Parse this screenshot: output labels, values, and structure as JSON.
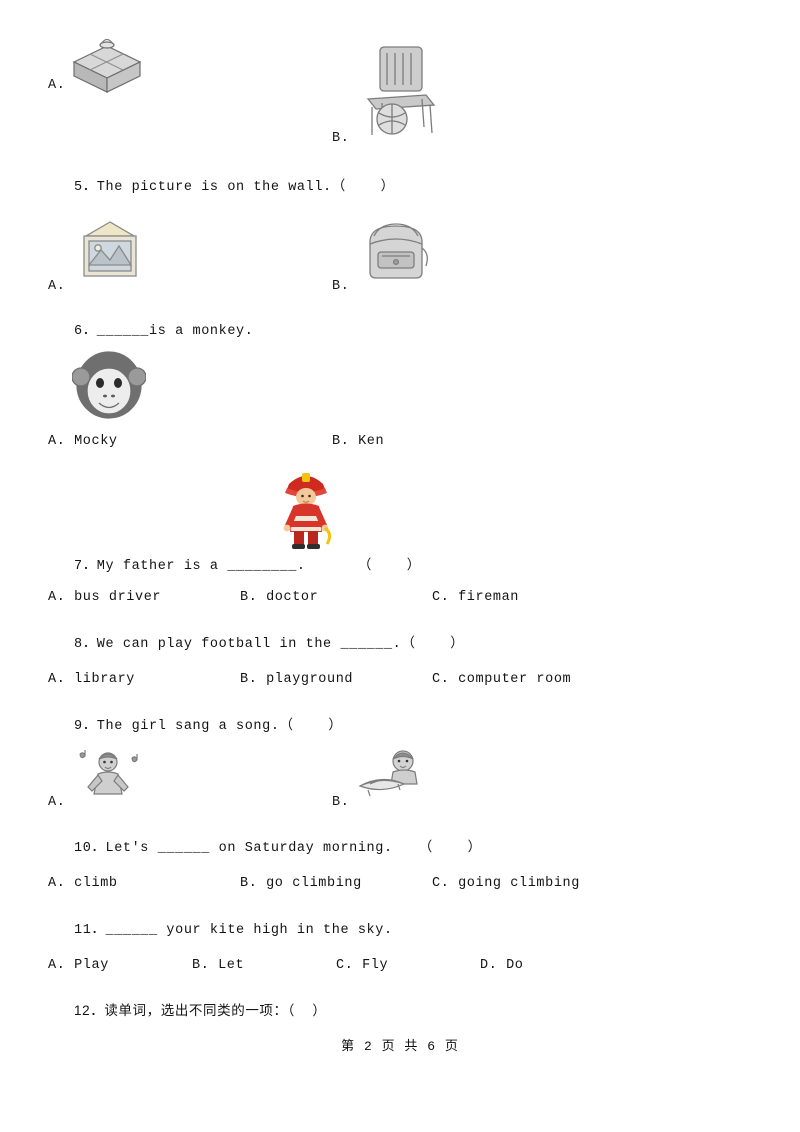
{
  "document": {
    "footer": "第 2 页 共 6 页",
    "footer_parts": {
      "prefix": "第",
      "page": "2",
      "mid": "页 共",
      "total": "6",
      "suffix": "页"
    }
  },
  "questions": [
    {
      "id": "q4-options",
      "kind": "image-options",
      "options": [
        {
          "label": "A.",
          "image": "cake-box-sketch"
        },
        {
          "label": "B.",
          "image": "chair-and-ball-sketch"
        }
      ]
    },
    {
      "id": "q5",
      "kind": "image-options",
      "text": "5．The picture is on the wall.（    ）",
      "options": [
        {
          "label": "A.",
          "image": "picture-frame-sketch"
        },
        {
          "label": "B.",
          "image": "schoolbag-sketch"
        }
      ]
    },
    {
      "id": "q6",
      "kind": "image-then-text-options",
      "text": "6．______is a monkey.",
      "image": "monkey-sketch",
      "options": [
        {
          "label": "A. Mocky"
        },
        {
          "label": "B. Ken"
        }
      ]
    },
    {
      "id": "q7",
      "kind": "image-then-text-options",
      "image": "fireman-color",
      "text": "7．My father is a ________.      （    ）",
      "options": [
        {
          "label": "A. bus driver"
        },
        {
          "label": "B. doctor"
        },
        {
          "label": "C. fireman"
        }
      ]
    },
    {
      "id": "q8",
      "kind": "text-options",
      "text": "8．We can play football in the ______.（    ）",
      "options": [
        {
          "label": "A. library"
        },
        {
          "label": "B. playground"
        },
        {
          "label": "C. computer room"
        }
      ]
    },
    {
      "id": "q9",
      "kind": "image-options",
      "text": "9．The girl sang a song.（    ）",
      "options": [
        {
          "label": "A.",
          "image": "girl-singing-sketch"
        },
        {
          "label": "B.",
          "image": "girl-reading-sketch"
        }
      ]
    },
    {
      "id": "q10",
      "kind": "text-options",
      "text": "10．Let's ______ on Saturday morning.   （    ）",
      "options": [
        {
          "label": "A. climb"
        },
        {
          "label": "B. go climbing"
        },
        {
          "label": "C. going climbing"
        }
      ]
    },
    {
      "id": "q11",
      "kind": "text-options",
      "text": "11．______ your kite high in the sky.",
      "options": [
        {
          "label": "A. Play"
        },
        {
          "label": "B. Let"
        },
        {
          "label": "C. Fly"
        },
        {
          "label": "D. Do"
        }
      ]
    },
    {
      "id": "q12",
      "kind": "text-only",
      "text": "12．读单词，选出不同类的一项：（    ）"
    }
  ],
  "colors": {
    "text": "#141414",
    "fireman_red": "#d8352a",
    "fireman_helmet": "#cf2a20",
    "sketch_gray": "#8a8a8a"
  }
}
